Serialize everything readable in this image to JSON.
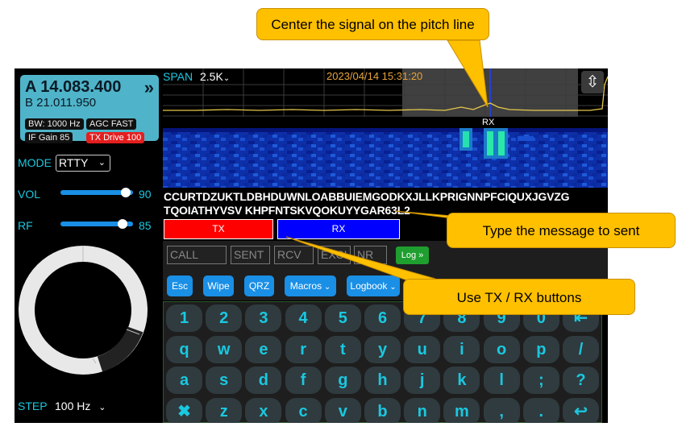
{
  "vfo": {
    "a_freq": "A 14.083.400",
    "arrow": "»",
    "b_freq": "B 21.011.950",
    "bw": "BW: 1000 Hz",
    "agc": "AGC FAST",
    "if_gain": "IF Gain 85",
    "tx_drive": "TX Drive 100"
  },
  "controls": {
    "mode_label": "MODE",
    "mode_value": "RTTY",
    "vol_label": "VOL",
    "vol_value": "90",
    "vol_level": 0.9,
    "rf_label": "RF",
    "rf_value": "85",
    "rf_level": 0.85,
    "step_label": "STEP",
    "step_value": "100 Hz"
  },
  "spectrum": {
    "span_label": "SPAN",
    "span_value": "2.5K",
    "datetime": "2023/04/14 15:31:20",
    "rx_marker": "RX"
  },
  "decoded_text": {
    "line1": "CCURTDZUKTLDBHDUWNLOABBUIEMGODKXJLLKPRIGNNPFCIQUXJGVZG",
    "line2": "TQOIATHYVSV KHPFNTSKVQOKUYYGAR63L2"
  },
  "buttons": {
    "tx": "TX",
    "rx": "RX",
    "log": "Log »",
    "esc": "Esc",
    "wipe": "Wipe",
    "qrz": "QRZ",
    "macros": "Macros",
    "logbook": "Logbook"
  },
  "log_fields": {
    "call": "CALL",
    "sent": "SENT",
    "rcv": "RCV",
    "exch": "EXCH",
    "nr": "NR"
  },
  "keyboard": {
    "row1": [
      "1",
      "2",
      "3",
      "4",
      "5",
      "6",
      "7",
      "8",
      "9",
      "0",
      "⇤"
    ],
    "row2": [
      "q",
      "w",
      "e",
      "r",
      "t",
      "y",
      "u",
      "i",
      "o",
      "p",
      "/"
    ],
    "row3": [
      "a",
      "s",
      "d",
      "f",
      "g",
      "h",
      "j",
      "k",
      "l",
      ";",
      "?"
    ],
    "row4": [
      "✖",
      "z",
      "x",
      "c",
      "v",
      "b",
      "n",
      "m",
      ",",
      ".",
      "↩"
    ]
  },
  "callouts": {
    "pitch": "Center the signal on the pitch line",
    "message": "Type the message to sent",
    "txrx": "Use TX / RX buttons"
  }
}
